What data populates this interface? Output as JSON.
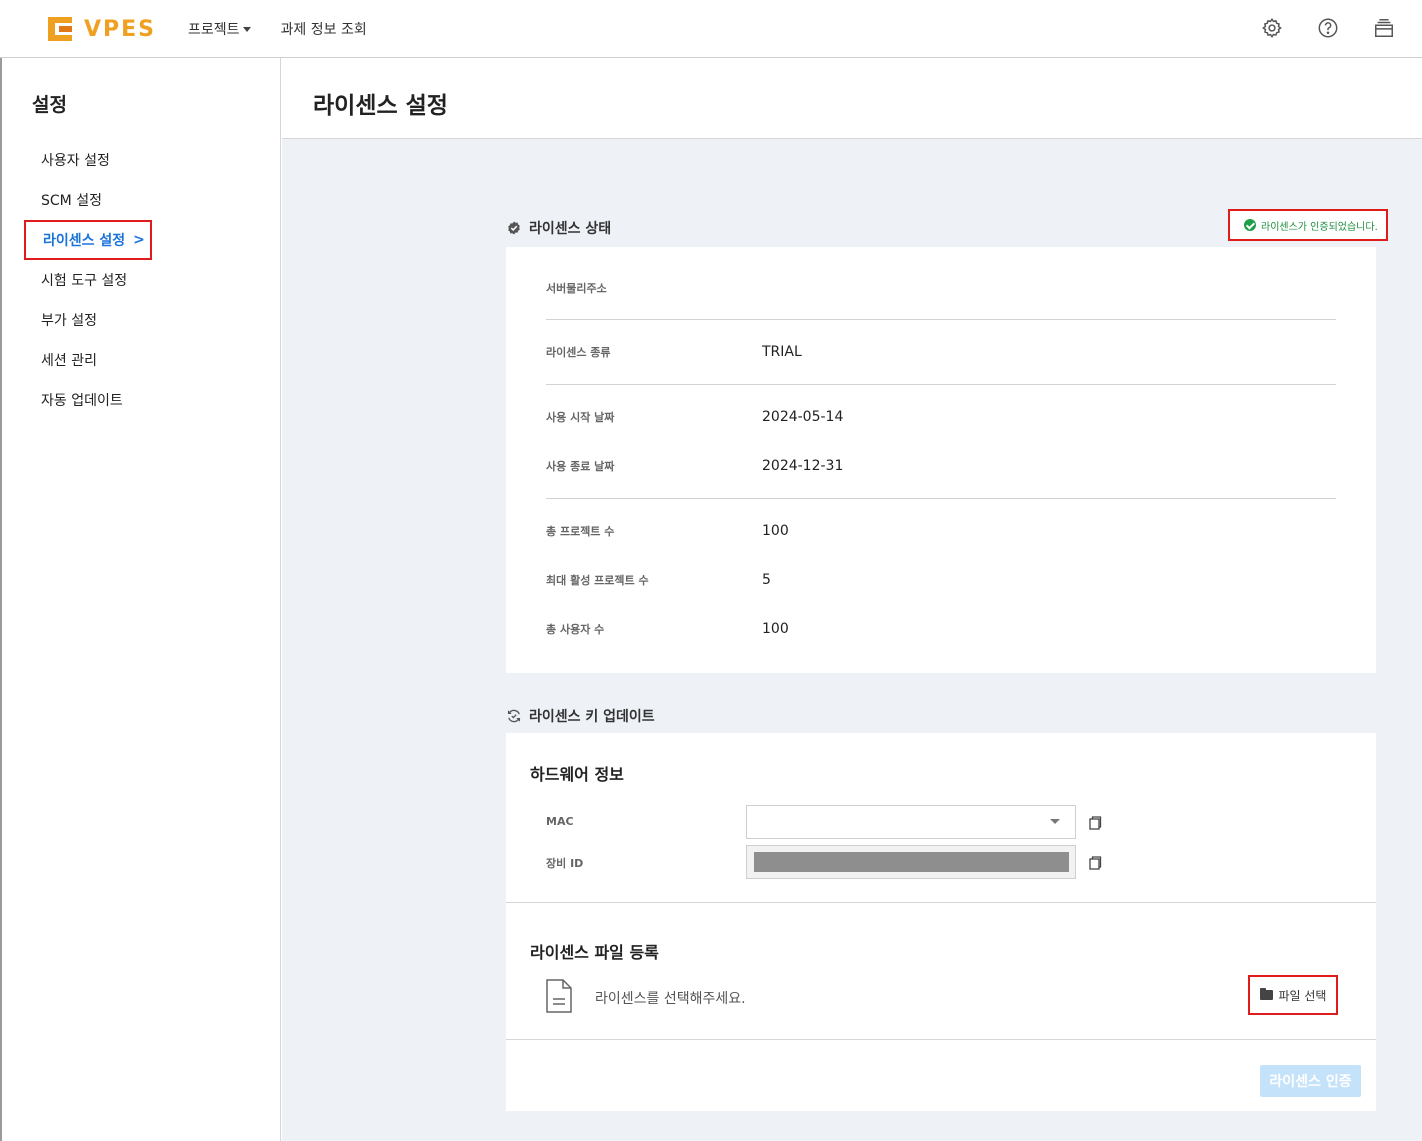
{
  "header": {
    "brand": "VPES",
    "nav": [
      {
        "label": "프로젝트",
        "has_caret": true
      },
      {
        "label": "과제 정보 조회",
        "has_caret": false
      }
    ],
    "icons": [
      "gear-icon",
      "help-icon",
      "layers-icon"
    ]
  },
  "sidebar": {
    "title": "설정",
    "items": [
      {
        "label": "사용자 설정",
        "active": false
      },
      {
        "label": "SCM 설정",
        "active": false
      },
      {
        "label": "라이센스 설정",
        "active": true
      },
      {
        "label": "시험 도구 설정",
        "active": false
      },
      {
        "label": "부가 설정",
        "active": false
      },
      {
        "label": "세션 관리",
        "active": false
      },
      {
        "label": "자동 업데이트",
        "active": false
      }
    ],
    "active_arrow": ">"
  },
  "page": {
    "title": "라이센스 설정"
  },
  "license_status": {
    "section_label": "라이센스 상태",
    "badge": "라이센스가 인증되었습니다.",
    "rows": [
      {
        "label": "서버물리주소",
        "value": ""
      },
      {
        "label": "라이센스 종류",
        "value": "TRIAL"
      },
      {
        "label": "사용 시작 날짜",
        "value": "2024-05-14"
      },
      {
        "label": "사용 종료 날짜",
        "value": "2024-12-31"
      },
      {
        "label": "총 프로젝트 수",
        "value": "100"
      },
      {
        "label": "최대 활성 프로젝트 수",
        "value": "5"
      },
      {
        "label": "총 사용자 수",
        "value": "100"
      }
    ]
  },
  "license_update": {
    "section_label": "라이센스 키 업데이트",
    "hardware": {
      "title": "하드웨어 정보",
      "mac_label": "MAC",
      "mac_value": "",
      "device_label": "장비 ID"
    },
    "file": {
      "title": "라이센스 파일 등록",
      "placeholder": "라이센스를 선택해주세요.",
      "select_button": "파일 선택"
    },
    "verify_button": "라이센스 인증"
  },
  "colors": {
    "accent": "#1a73d9",
    "brand": "#f0a020",
    "success": "#1e9e48",
    "highlight_border": "#e01b1b",
    "background": "#eef2f6"
  }
}
